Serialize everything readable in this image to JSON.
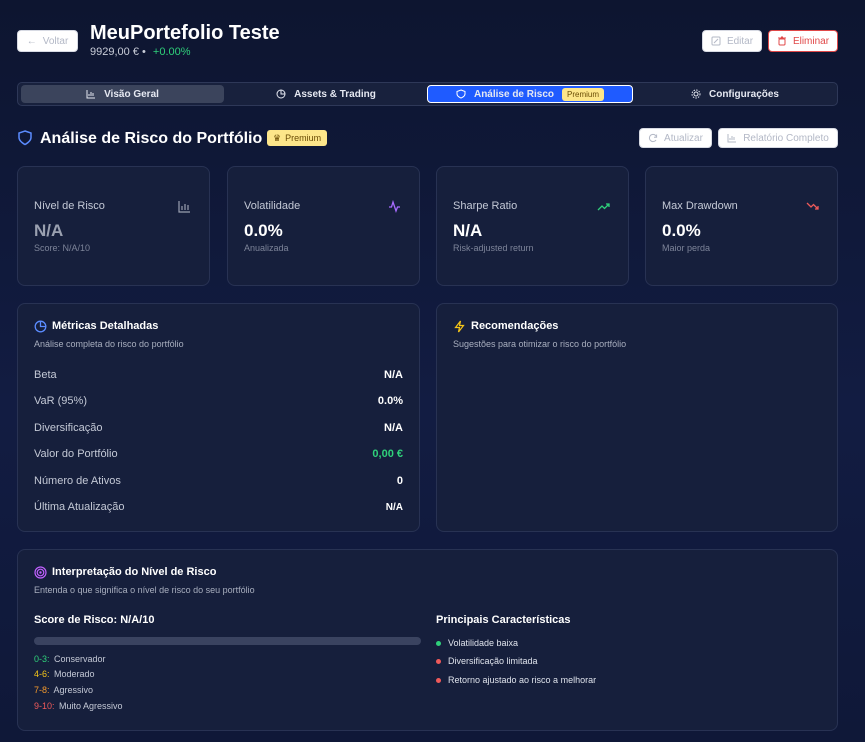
{
  "header": {
    "back_label": "Voltar",
    "title": "MeuPortefolio Teste",
    "balance": "9929,00 € •",
    "change": "+0.00%",
    "edit_label": "Editar",
    "delete_label": "Eliminar"
  },
  "tabs": [
    {
      "label": "Visão Geral"
    },
    {
      "label": "Assets & Trading"
    },
    {
      "label": "Análise de Risco",
      "badge": "Premium"
    },
    {
      "label": "Configurações"
    }
  ],
  "section": {
    "title": "Análise de Risco do Portfólio",
    "badge": "Premium",
    "refresh_label": "Atualizar",
    "report_label": "Relatório Completo"
  },
  "stats": [
    {
      "label": "Nível de Risco",
      "value": "N/A",
      "sub": "Score: N/A/10",
      "icon": "bar-chart-icon"
    },
    {
      "label": "Volatilidade",
      "value": "0.0%",
      "sub": "Anualizada",
      "icon": "activity-icon"
    },
    {
      "label": "Sharpe Ratio",
      "value": "N/A",
      "sub": "Risk-adjusted return",
      "icon": "trend-up-icon"
    },
    {
      "label": "Max Drawdown",
      "value": "0.0%",
      "sub": "Maior perda",
      "icon": "trend-down-icon"
    }
  ],
  "metrics": {
    "title": "Métricas Detalhadas",
    "desc": "Análise completa do risco do portfólio",
    "rows": [
      {
        "k": "Beta",
        "v": "N/A"
      },
      {
        "k": "VaR (95%)",
        "v": "0.0%"
      },
      {
        "k": "Diversificação",
        "v": "N/A"
      },
      {
        "k": "Valor do Portfólio",
        "v": "0,00 €"
      },
      {
        "k": "Número de Ativos",
        "v": "0"
      },
      {
        "k": "Última Atualização",
        "v": "N/A"
      }
    ]
  },
  "recommendations": {
    "title": "Recomendações",
    "desc": "Sugestões para otimizar o risco do portfólio"
  },
  "interpretation": {
    "title": "Interpretação do Nível de Risco",
    "desc": "Entenda o que significa o nível de risco do seu portfólio",
    "score_label": "Score de Risco: N/A/10",
    "score_fraction": 0,
    "legend": [
      {
        "range": "0-3:",
        "text": "Conservador",
        "color": "#2fd07a"
      },
      {
        "range": "4-6:",
        "text": "Moderado",
        "color": "#f5c518"
      },
      {
        "range": "7-8:",
        "text": "Agressivo",
        "color": "#f59a2c"
      },
      {
        "range": "9-10:",
        "text": "Muito Agressivo",
        "color": "#ef5a5a"
      }
    ],
    "characteristics_title": "Principais Características",
    "characteristics": [
      {
        "text": "Volatilidade baixa",
        "color": "#2fd07a"
      },
      {
        "text": "Diversificação limitada",
        "color": "#ef5a5a"
      },
      {
        "text": "Retorno ajustado ao risco a melhorar",
        "color": "#ef5a5a"
      }
    ]
  },
  "colors": {
    "accent": "#1f5bff",
    "positive": "#2fd07a",
    "danger": "#e04848",
    "premium": "#fde68a"
  }
}
